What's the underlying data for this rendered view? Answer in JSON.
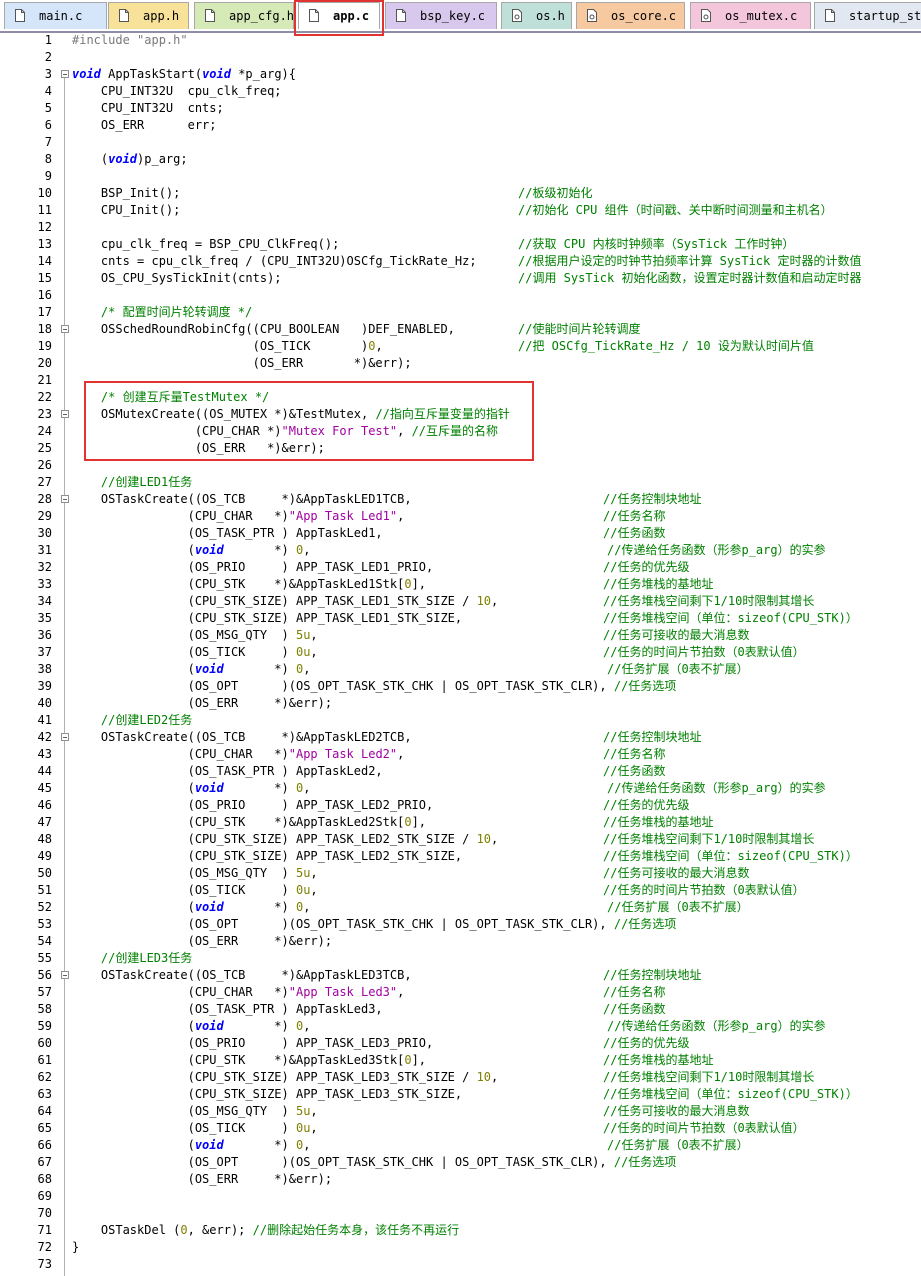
{
  "tabs": [
    {
      "label": "main.c",
      "bg": "#d6e6fa",
      "icon": "file-icon"
    },
    {
      "label": "app.h",
      "bg": "#f8e29a",
      "icon": "file-icon"
    },
    {
      "label": "app_cfg.h",
      "bg": "#d6eab8",
      "icon": "file-icon"
    },
    {
      "label": "app.c",
      "bg": "#ffffff",
      "icon": "file-icon",
      "active": true
    },
    {
      "label": "bsp_key.c",
      "bg": "#d9c8ee",
      "icon": "file-icon"
    },
    {
      "label": "os.h",
      "bg": "#bfe0d8",
      "icon": "header-file-icon"
    },
    {
      "label": "os_core.c",
      "bg": "#f6c9a0",
      "icon": "header-file-icon"
    },
    {
      "label": "os_mutex.c",
      "bg": "#f4c6dc",
      "icon": "header-file-icon"
    },
    {
      "label": "startup_st",
      "bg": "#e2e8f2",
      "icon": "file-icon"
    }
  ],
  "colors": {
    "accent_highlight": "#e23333",
    "keyword": "#0000ff",
    "comment": "#008000",
    "string": "#a000a0",
    "number": "#808000"
  },
  "lines": [
    {
      "n": "1",
      "parts": [
        [
          "p",
          "#include \"app.h\""
        ]
      ]
    },
    {
      "n": "2",
      "parts": []
    },
    {
      "n": "3",
      "fold": true,
      "parts": [
        [
          "k",
          "void"
        ],
        [
          "t",
          " AppTaskStart("
        ],
        [
          "k",
          "void"
        ],
        [
          "t",
          " *p_arg){"
        ]
      ]
    },
    {
      "n": "4",
      "parts": [
        [
          "t",
          "    CPU_INT32U  cpu_clk_freq;"
        ]
      ]
    },
    {
      "n": "5",
      "parts": [
        [
          "t",
          "    CPU_INT32U  cnts;"
        ]
      ]
    },
    {
      "n": "6",
      "parts": [
        [
          "t",
          "    OS_ERR      err;"
        ]
      ]
    },
    {
      "n": "7",
      "parts": []
    },
    {
      "n": "8",
      "parts": [
        [
          "t",
          "    ("
        ],
        [
          "k",
          "void"
        ],
        [
          "t",
          ")p_arg;"
        ]
      ]
    },
    {
      "n": "9",
      "parts": []
    },
    {
      "n": "10",
      "parts": [
        [
          "t",
          "    BSP_Init();"
        ]
      ],
      "cm": "//板级初始化",
      "cmx": 518
    },
    {
      "n": "11",
      "parts": [
        [
          "t",
          "    CPU_Init();"
        ]
      ],
      "cm": "//初始化 CPU 组件（时间戳、关中断时间测量和主机名）",
      "cmx": 518
    },
    {
      "n": "12",
      "parts": []
    },
    {
      "n": "13",
      "parts": [
        [
          "t",
          "    cpu_clk_freq = BSP_CPU_ClkFreq();"
        ]
      ],
      "cm": "//获取 CPU 内核时钟频率（SysTick 工作时钟）",
      "cmx": 518
    },
    {
      "n": "14",
      "parts": [
        [
          "t",
          "    cnts = cpu_clk_freq / (CPU_INT32U)OSCfg_TickRate_Hz;"
        ]
      ],
      "cm": "//根据用户设定的时钟节拍频率计算 SysTick 定时器的计数值",
      "cmx": 518
    },
    {
      "n": "15",
      "parts": [
        [
          "t",
          "    OS_CPU_SysTickInit(cnts);"
        ]
      ],
      "cm": "//调用 SysTick 初始化函数，设置定时器计数值和启动定时器",
      "cmx": 518
    },
    {
      "n": "16",
      "parts": []
    },
    {
      "n": "17",
      "parts": [
        [
          "c",
          "    /* 配置时间片轮转调度 */"
        ]
      ]
    },
    {
      "n": "18",
      "fold": true,
      "parts": [
        [
          "t",
          "    OSSchedRoundRobinCfg((CPU_BOOLEAN   )DEF_ENABLED,"
        ]
      ],
      "cm": "//使能时间片轮转调度",
      "cmx": 518
    },
    {
      "n": "19",
      "parts": [
        [
          "t",
          "                         (OS_TICK       )"
        ],
        [
          "n",
          "0"
        ],
        [
          "t",
          ","
        ]
      ],
      "cm": "//把 OSCfg_TickRate_Hz / 10 设为默认时间片值",
      "cmx": 518
    },
    {
      "n": "20",
      "parts": [
        [
          "t",
          "                         (OS_ERR       *)&err);"
        ]
      ]
    },
    {
      "n": "21",
      "parts": []
    },
    {
      "n": "22",
      "parts": [
        [
          "c",
          "    /* 创建互斥量TestMutex */"
        ]
      ]
    },
    {
      "n": "23",
      "fold": true,
      "parts": [
        [
          "t",
          "    OSMutexCreate((OS_MUTEX *)&TestMutex, "
        ],
        [
          "c",
          "//指向互斥量变量的指针"
        ]
      ]
    },
    {
      "n": "24",
      "parts": [
        [
          "t",
          "                 (CPU_CHAR *)"
        ],
        [
          "s",
          "\"Mutex For Test\""
        ],
        [
          "t",
          ", "
        ],
        [
          "c",
          "//互斥量的名称"
        ]
      ]
    },
    {
      "n": "25",
      "parts": [
        [
          "t",
          "                 (OS_ERR   *)&err);"
        ]
      ]
    },
    {
      "n": "26",
      "parts": []
    },
    {
      "n": "27",
      "parts": [
        [
          "c",
          "    //创建LED1任务"
        ]
      ]
    },
    {
      "n": "28",
      "fold": true,
      "parts": [
        [
          "t",
          "    OSTaskCreate((OS_TCB     *)&AppTaskLED1TCB,"
        ]
      ],
      "cm": "//任务控制块地址",
      "cmx": 603
    },
    {
      "n": "29",
      "parts": [
        [
          "t",
          "                (CPU_CHAR   *)"
        ],
        [
          "s",
          "\"App Task Led1\""
        ],
        [
          "t",
          ","
        ]
      ],
      "cm": "//任务名称",
      "cmx": 603
    },
    {
      "n": "30",
      "parts": [
        [
          "t",
          "                (OS_TASK_PTR ) AppTaskLed1,"
        ]
      ],
      "cm": "//任务函数",
      "cmx": 603
    },
    {
      "n": "31",
      "parts": [
        [
          "t",
          "                ("
        ],
        [
          "k",
          "void"
        ],
        [
          "t",
          "       *) "
        ],
        [
          "n",
          "0"
        ],
        [
          "t",
          ","
        ]
      ],
      "cm": "//传递给任务函数（形参p_arg）的实参",
      "cmx": 607
    },
    {
      "n": "32",
      "parts": [
        [
          "t",
          "                (OS_PRIO     ) APP_TASK_LED1_PRIO,"
        ]
      ],
      "cm": "//任务的优先级",
      "cmx": 603
    },
    {
      "n": "33",
      "parts": [
        [
          "t",
          "                (CPU_STK    *)&AppTaskLed1Stk["
        ],
        [
          "n",
          "0"
        ],
        [
          "t",
          "],"
        ]
      ],
      "cm": "//任务堆栈的基地址",
      "cmx": 603
    },
    {
      "n": "34",
      "parts": [
        [
          "t",
          "                (CPU_STK_SIZE) APP_TASK_LED1_STK_SIZE / "
        ],
        [
          "n",
          "10"
        ],
        [
          "t",
          ","
        ]
      ],
      "cm": "//任务堆栈空间剩下1/10时限制其增长",
      "cmx": 603
    },
    {
      "n": "35",
      "parts": [
        [
          "t",
          "                (CPU_STK_SIZE) APP_TASK_LED1_STK_SIZE,"
        ]
      ],
      "cm": "//任务堆栈空间（单位：sizeof(CPU_STK)）",
      "cmx": 603
    },
    {
      "n": "36",
      "parts": [
        [
          "t",
          "                (OS_MSG_QTY  ) "
        ],
        [
          "n",
          "5u"
        ],
        [
          "t",
          ","
        ]
      ],
      "cm": "//任务可接收的最大消息数",
      "cmx": 603
    },
    {
      "n": "37",
      "parts": [
        [
          "t",
          "                (OS_TICK     ) "
        ],
        [
          "n",
          "0u"
        ],
        [
          "t",
          ","
        ]
      ],
      "cm": "//任务的时间片节拍数（0表默认值）",
      "cmx": 603
    },
    {
      "n": "38",
      "parts": [
        [
          "t",
          "                ("
        ],
        [
          "k",
          "void"
        ],
        [
          "t",
          "       *) "
        ],
        [
          "n",
          "0"
        ],
        [
          "t",
          ","
        ]
      ],
      "cm": "//任务扩展（0表不扩展）",
      "cmx": 607
    },
    {
      "n": "39",
      "parts": [
        [
          "t",
          "                (OS_OPT      )(OS_OPT_TASK_STK_CHK | OS_OPT_TASK_STK_CLR), "
        ],
        [
          "c",
          "//任务选项"
        ]
      ]
    },
    {
      "n": "40",
      "parts": [
        [
          "t",
          "                (OS_ERR     *)&err);"
        ]
      ]
    },
    {
      "n": "41",
      "parts": [
        [
          "c",
          "    //创建LED2任务"
        ]
      ]
    },
    {
      "n": "42",
      "fold": true,
      "parts": [
        [
          "t",
          "    OSTaskCreate((OS_TCB     *)&AppTaskLED2TCB,"
        ]
      ],
      "cm": "//任务控制块地址",
      "cmx": 603
    },
    {
      "n": "43",
      "parts": [
        [
          "t",
          "                (CPU_CHAR   *)"
        ],
        [
          "s",
          "\"App Task Led2\""
        ],
        [
          "t",
          ","
        ]
      ],
      "cm": "//任务名称",
      "cmx": 603
    },
    {
      "n": "44",
      "parts": [
        [
          "t",
          "                (OS_TASK_PTR ) AppTaskLed2,"
        ]
      ],
      "cm": "//任务函数",
      "cmx": 603
    },
    {
      "n": "45",
      "parts": [
        [
          "t",
          "                ("
        ],
        [
          "k",
          "void"
        ],
        [
          "t",
          "       *) "
        ],
        [
          "n",
          "0"
        ],
        [
          "t",
          ","
        ]
      ],
      "cm": "//传递给任务函数（形参p_arg）的实参",
      "cmx": 607
    },
    {
      "n": "46",
      "parts": [
        [
          "t",
          "                (OS_PRIO     ) APP_TASK_LED2_PRIO,"
        ]
      ],
      "cm": "//任务的优先级",
      "cmx": 603
    },
    {
      "n": "47",
      "parts": [
        [
          "t",
          "                (CPU_STK    *)&AppTaskLed2Stk["
        ],
        [
          "n",
          "0"
        ],
        [
          "t",
          "],"
        ]
      ],
      "cm": "//任务堆栈的基地址",
      "cmx": 603
    },
    {
      "n": "48",
      "parts": [
        [
          "t",
          "                (CPU_STK_SIZE) APP_TASK_LED2_STK_SIZE / "
        ],
        [
          "n",
          "10"
        ],
        [
          "t",
          ","
        ]
      ],
      "cm": "//任务堆栈空间剩下1/10时限制其增长",
      "cmx": 603
    },
    {
      "n": "49",
      "parts": [
        [
          "t",
          "                (CPU_STK_SIZE) APP_TASK_LED2_STK_SIZE,"
        ]
      ],
      "cm": "//任务堆栈空间（单位：sizeof(CPU_STK)）",
      "cmx": 603
    },
    {
      "n": "50",
      "parts": [
        [
          "t",
          "                (OS_MSG_QTY  ) "
        ],
        [
          "n",
          "5u"
        ],
        [
          "t",
          ","
        ]
      ],
      "cm": "//任务可接收的最大消息数",
      "cmx": 603
    },
    {
      "n": "51",
      "parts": [
        [
          "t",
          "                (OS_TICK     ) "
        ],
        [
          "n",
          "0u"
        ],
        [
          "t",
          ","
        ]
      ],
      "cm": "//任务的时间片节拍数（0表默认值）",
      "cmx": 603
    },
    {
      "n": "52",
      "parts": [
        [
          "t",
          "                ("
        ],
        [
          "k",
          "void"
        ],
        [
          "t",
          "       *) "
        ],
        [
          "n",
          "0"
        ],
        [
          "t",
          ","
        ]
      ],
      "cm": "//任务扩展（0表不扩展）",
      "cmx": 607
    },
    {
      "n": "53",
      "parts": [
        [
          "t",
          "                (OS_OPT      )(OS_OPT_TASK_STK_CHK | OS_OPT_TASK_STK_CLR), "
        ],
        [
          "c",
          "//任务选项"
        ]
      ]
    },
    {
      "n": "54",
      "parts": [
        [
          "t",
          "                (OS_ERR     *)&err);"
        ]
      ]
    },
    {
      "n": "55",
      "parts": [
        [
          "c",
          "    //创建LED3任务"
        ]
      ]
    },
    {
      "n": "56",
      "fold": true,
      "parts": [
        [
          "t",
          "    OSTaskCreate((OS_TCB     *)&AppTaskLED3TCB,"
        ]
      ],
      "cm": "//任务控制块地址",
      "cmx": 603
    },
    {
      "n": "57",
      "parts": [
        [
          "t",
          "                (CPU_CHAR   *)"
        ],
        [
          "s",
          "\"App Task Led3\""
        ],
        [
          "t",
          ","
        ]
      ],
      "cm": "//任务名称",
      "cmx": 603
    },
    {
      "n": "58",
      "parts": [
        [
          "t",
          "                (OS_TASK_PTR ) AppTaskLed3,"
        ]
      ],
      "cm": "//任务函数",
      "cmx": 603
    },
    {
      "n": "59",
      "parts": [
        [
          "t",
          "                ("
        ],
        [
          "k",
          "void"
        ],
        [
          "t",
          "       *) "
        ],
        [
          "n",
          "0"
        ],
        [
          "t",
          ","
        ]
      ],
      "cm": "//传递给任务函数（形参p_arg）的实参",
      "cmx": 607
    },
    {
      "n": "60",
      "parts": [
        [
          "t",
          "                (OS_PRIO     ) APP_TASK_LED3_PRIO,"
        ]
      ],
      "cm": "//任务的优先级",
      "cmx": 603
    },
    {
      "n": "61",
      "parts": [
        [
          "t",
          "                (CPU_STK    *)&AppTaskLed3Stk["
        ],
        [
          "n",
          "0"
        ],
        [
          "t",
          "],"
        ]
      ],
      "cm": "//任务堆栈的基地址",
      "cmx": 603
    },
    {
      "n": "62",
      "parts": [
        [
          "t",
          "                (CPU_STK_SIZE) APP_TASK_LED3_STK_SIZE / "
        ],
        [
          "n",
          "10"
        ],
        [
          "t",
          ","
        ]
      ],
      "cm": "//任务堆栈空间剩下1/10时限制其增长",
      "cmx": 603
    },
    {
      "n": "63",
      "parts": [
        [
          "t",
          "                (CPU_STK_SIZE) APP_TASK_LED3_STK_SIZE,"
        ]
      ],
      "cm": "//任务堆栈空间（单位：sizeof(CPU_STK)）",
      "cmx": 603
    },
    {
      "n": "64",
      "parts": [
        [
          "t",
          "                (OS_MSG_QTY  ) "
        ],
        [
          "n",
          "5u"
        ],
        [
          "t",
          ","
        ]
      ],
      "cm": "//任务可接收的最大消息数",
      "cmx": 603
    },
    {
      "n": "65",
      "parts": [
        [
          "t",
          "                (OS_TICK     ) "
        ],
        [
          "n",
          "0u"
        ],
        [
          "t",
          ","
        ]
      ],
      "cm": "//任务的时间片节拍数（0表默认值）",
      "cmx": 603
    },
    {
      "n": "66",
      "parts": [
        [
          "t",
          "                ("
        ],
        [
          "k",
          "void"
        ],
        [
          "t",
          "       *) "
        ],
        [
          "n",
          "0"
        ],
        [
          "t",
          ","
        ]
      ],
      "cm": "//任务扩展（0表不扩展）",
      "cmx": 607
    },
    {
      "n": "67",
      "parts": [
        [
          "t",
          "                (OS_OPT      )(OS_OPT_TASK_STK_CHK | OS_OPT_TASK_STK_CLR), "
        ],
        [
          "c",
          "//任务选项"
        ]
      ]
    },
    {
      "n": "68",
      "parts": [
        [
          "t",
          "                (OS_ERR     *)&err);"
        ]
      ]
    },
    {
      "n": "69",
      "parts": []
    },
    {
      "n": "70",
      "parts": []
    },
    {
      "n": "71",
      "parts": [
        [
          "t",
          "    OSTaskDel ("
        ],
        [
          "n",
          "0"
        ],
        [
          "t",
          ", &err); "
        ],
        [
          "c",
          "//删除起始任务本身，该任务不再运行"
        ]
      ]
    },
    {
      "n": "72",
      "parts": [
        [
          "t",
          "}"
        ]
      ]
    },
    {
      "n": "73",
      "parts": []
    }
  ]
}
